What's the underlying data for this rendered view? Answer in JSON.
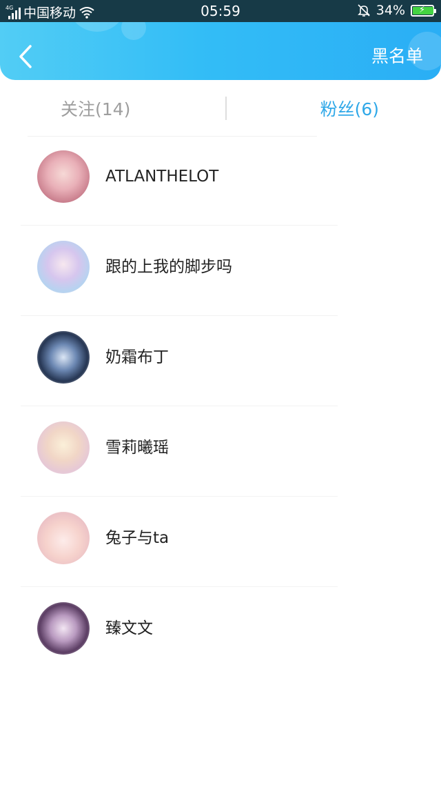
{
  "status_bar": {
    "network_type": "4G",
    "carrier": "中国移动",
    "time": "05:59",
    "battery_percent": "34%",
    "icons": [
      "signal-icon",
      "wifi-icon",
      "mute-bell-icon",
      "battery-charging-icon"
    ]
  },
  "header": {
    "back_icon": "chevron-left-icon",
    "blacklist_label": "黑名单"
  },
  "tabs": [
    {
      "label": "关注(14)",
      "active": false
    },
    {
      "label": "粉丝(6)",
      "active": true
    }
  ],
  "fans": [
    {
      "name": "ATLANTHELOT"
    },
    {
      "name": "跟的上我的脚步吗"
    },
    {
      "name": "奶霜布丁"
    },
    {
      "name": "雪莉曦瑶"
    },
    {
      "name": "兔子与ta"
    },
    {
      "name": "臻文文"
    }
  ],
  "colors": {
    "header_gradient_start": "#52cdf5",
    "header_gradient_end": "#2aaef5",
    "active_tab": "#2fa8e8",
    "inactive_tab": "#9e9e9e",
    "status_bar_bg": "#173a47",
    "battery_fill": "#43d442"
  }
}
